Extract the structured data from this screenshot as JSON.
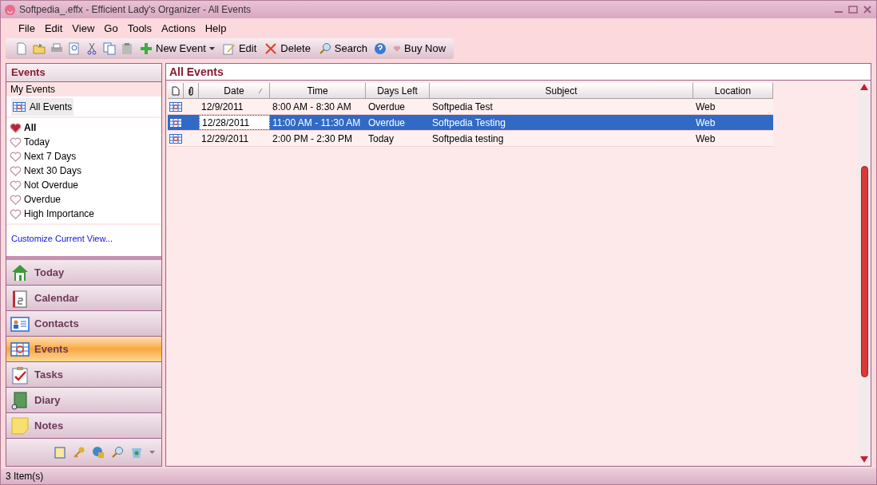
{
  "window": {
    "title": "Softpedia_.effx - Efficient Lady's Organizer - All Events"
  },
  "menu": [
    "File",
    "Edit",
    "View",
    "Go",
    "Tools",
    "Actions",
    "Help"
  ],
  "toolbar": [
    {
      "kind": "icon"
    },
    {
      "kind": "icon"
    },
    {
      "kind": "icon"
    },
    {
      "kind": "icon"
    },
    {
      "kind": "icon"
    },
    {
      "kind": "icon"
    },
    {
      "kind": "icon"
    },
    {
      "kind": "button",
      "label": "New Event",
      "dropdown": true
    },
    {
      "kind": "button",
      "label": "Edit",
      "dropdown": false
    },
    {
      "kind": "button",
      "label": "Delete",
      "dropdown": false
    },
    {
      "kind": "button",
      "label": "Search",
      "dropdown": false
    },
    {
      "kind": "icon"
    },
    {
      "kind": "button",
      "label": "Buy Now",
      "dropdown": false
    }
  ],
  "sidebar": {
    "title": "Events",
    "section": "My Events",
    "folder": {
      "label": "All Events",
      "selected": true
    },
    "filters": [
      {
        "label": "All",
        "selected": true
      },
      {
        "label": "Today",
        "selected": false
      },
      {
        "label": "Next 7 Days",
        "selected": false
      },
      {
        "label": "Next 30 Days",
        "selected": false
      },
      {
        "label": "Not Overdue",
        "selected": false
      },
      {
        "label": "Overdue",
        "selected": false
      },
      {
        "label": "High Importance",
        "selected": false
      }
    ],
    "link": "Customize Current View...",
    "nav": [
      {
        "label": "Today",
        "selected": false
      },
      {
        "label": "Calendar",
        "selected": false
      },
      {
        "label": "Contacts",
        "selected": false
      },
      {
        "label": "Events",
        "selected": true
      },
      {
        "label": "Tasks",
        "selected": false
      },
      {
        "label": "Diary",
        "selected": false
      },
      {
        "label": "Notes",
        "selected": false
      }
    ]
  },
  "content": {
    "title": "All Events",
    "columns": [
      "Date",
      "Time",
      "Days Left",
      "Subject",
      "Location"
    ],
    "rows": [
      {
        "date": "12/9/2011",
        "time": "8:00 AM - 8:30 AM",
        "days_left": "Overdue",
        "subject": "Softpedia Test",
        "location": "Web",
        "selected": false
      },
      {
        "date": "12/28/2011",
        "time": "11:00 AM - 11:30 AM",
        "days_left": "Overdue",
        "subject": "Softpedia Testing",
        "location": "Web",
        "selected": true
      },
      {
        "date": "12/29/2011",
        "time": "2:00 PM - 2:30 PM",
        "days_left": "Today",
        "subject": "Softpedia testing",
        "location": "Web",
        "selected": false
      }
    ]
  },
  "status_bar": "3 Item(s)"
}
